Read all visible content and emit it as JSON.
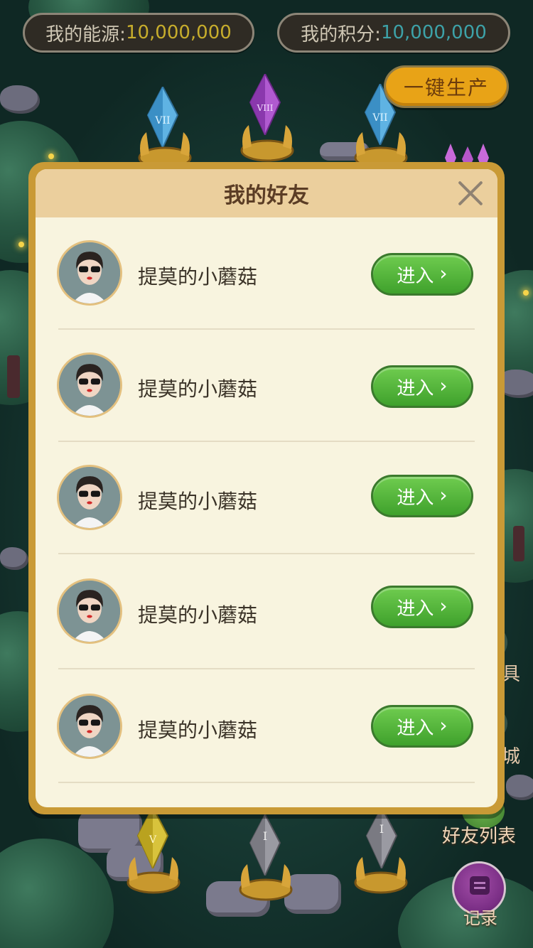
{
  "hud": {
    "energy_label": "我的能源: ",
    "energy_value": "10,000,000",
    "points_label": "我的积分: ",
    "points_value": "10,000,000",
    "produce_button": "一键生产"
  },
  "side": {
    "tools_partial": "具",
    "shop_partial": "城",
    "friends_list": "好友列表",
    "record": "记录"
  },
  "dialog": {
    "title": "我的好友",
    "friends": [
      {
        "name": "提莫的小蘑菇",
        "enter": "进入"
      },
      {
        "name": "提莫的小蘑菇",
        "enter": "进入"
      },
      {
        "name": "提莫的小蘑菇",
        "enter": "进入"
      },
      {
        "name": "提莫的小蘑菇",
        "enter": "进入"
      },
      {
        "name": "提莫的小蘑菇",
        "enter": "进入"
      }
    ]
  },
  "crystals": {
    "top": [
      "VII",
      "VIII",
      "VII"
    ],
    "bottom": [
      "V",
      "I",
      "I"
    ]
  },
  "colors": {
    "dialog_frame": "#c99a36",
    "dialog_bg": "#f8f4df",
    "header_bg": "#ebcf9d",
    "enter_button": "#4fb23a",
    "produce_button": "#e8a317"
  }
}
